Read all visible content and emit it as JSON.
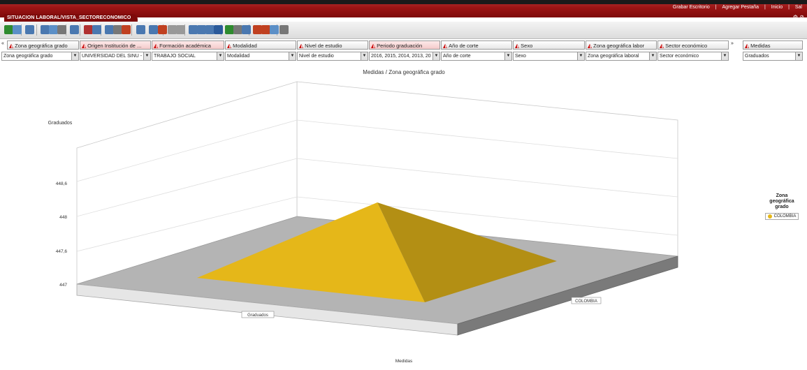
{
  "window": {
    "tab_title": "SITUACION LABORAL/VISTA_SECTORECONOMICO",
    "links": [
      "Grabar Escritorio",
      "|",
      "Agregar Pestaña",
      "|",
      "Inicio",
      "|",
      "Sal"
    ],
    "right_icons": "⚙ ⊘"
  },
  "toolbar": {
    "icons": [
      "back-icon",
      "refresh-icon",
      "grid-icon",
      "print-icon",
      "export-icon",
      "copy-icon",
      "save-icon",
      "chart-bar-icon",
      "chart-pie-icon",
      "table-icon",
      "filter-icon",
      "chart-line-icon",
      "layout-icon",
      "table-view-icon",
      "chart-toggle-icon",
      "sort-asc-icon",
      "sort-desc-icon",
      "pivot-icon",
      "pivot2-icon",
      "pivot3-icon",
      "book-icon",
      "settings-icon",
      "dropdown-icon",
      "bookmark-icon",
      "tools-icon",
      "star-icon",
      "people-icon",
      "help-icon"
    ]
  },
  "dimensions": [
    {
      "label": "Zona geográfica grado",
      "selected": "Zona geográfica grado",
      "active": false
    },
    {
      "label": "Origen Institución de ...",
      "selected": "UNIVERSIDAD DEL SINU - E",
      "active": true
    },
    {
      "label": "Formación académica",
      "selected": "TRABAJO SOCIAL",
      "active": true
    },
    {
      "label": "Modalidad",
      "selected": "Modalidad",
      "active": false
    },
    {
      "label": "Nivel de estudio",
      "selected": "Nivel de estudio",
      "active": false
    },
    {
      "label": "Periodo graduación",
      "selected": "2016, 2015, 2014, 2013, 20",
      "active": true
    },
    {
      "label": "Año de corte",
      "selected": "Año de corte",
      "active": false
    },
    {
      "label": "Sexo",
      "selected": "Sexo",
      "active": false
    },
    {
      "label": "Zona geográfica labor",
      "selected": "Zona geográfica laboral",
      "active": false
    },
    {
      "label": "Sector económico",
      "selected": "Sector económico",
      "active": false
    },
    {
      "label": "Medidas",
      "selected": "Graduados",
      "active": false
    }
  ],
  "chart_data": {
    "type": "pyramid3d",
    "title": "Medidas / Zona geográfica grado",
    "ylabel": "Graduados",
    "xlabel": "Medidas",
    "yticks": [
      "448,6",
      "448",
      "447,6",
      "447"
    ],
    "category_label": "Graduados",
    "series_label": "COLOMBIA",
    "series": [
      {
        "name": "COLOMBIA",
        "color": "#e5b719"
      }
    ]
  },
  "legend": {
    "title_lines": [
      "Zona",
      "geográfica",
      "grado"
    ],
    "item": "COLOMBIA"
  }
}
